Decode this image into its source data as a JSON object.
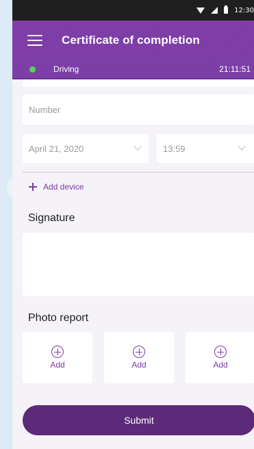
{
  "status_bar": {
    "time": "12:30",
    "icons": [
      "wifi-icon",
      "signal-icon",
      "battery-icon"
    ]
  },
  "app_bar": {
    "title": "Certificate of completion",
    "menu_icon": "hamburger-menu-icon"
  },
  "status_strip": {
    "label": "Driving",
    "time": "21:11:51",
    "indicator_color": "#4ddc4d"
  },
  "form": {
    "number_placeholder": "Number",
    "date_value": "April 21, 2020",
    "time_value": "13:59",
    "add_device_label": "Add device"
  },
  "signature": {
    "title": "Signature"
  },
  "photo_report": {
    "title": "Photo report",
    "tiles": [
      {
        "label": "Add"
      },
      {
        "label": "Add"
      },
      {
        "label": "Add"
      }
    ]
  },
  "submit_label": "Submit",
  "colors": {
    "accent": "#7c3aa5",
    "button": "#5c2a78",
    "background": "#f5f3f7"
  }
}
